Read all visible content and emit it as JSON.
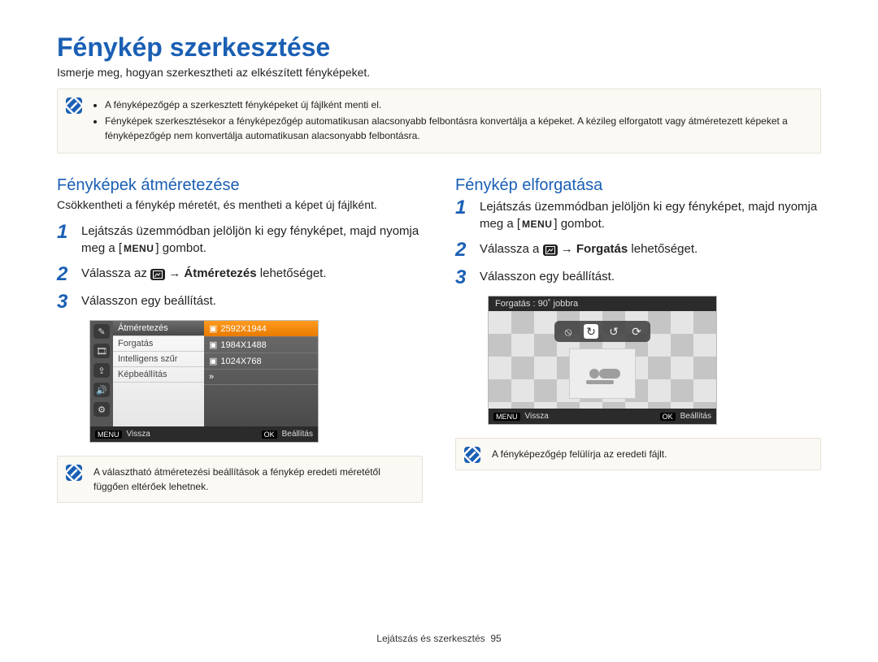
{
  "page": {
    "title": "Fénykép szerkesztése",
    "subtitle": "Ismerje meg, hogyan szerkesztheti az elkészített fényképeket.",
    "footer_section": "Lejátszás és szerkesztés",
    "footer_page": "95"
  },
  "top_note": {
    "bullet1": "A fényképezőgép a szerkesztett fényképeket új fájlként menti el.",
    "bullet2": "Fényképek szerkesztésekor a fényképezőgép automatikusan alacsonyabb felbontásra konvertálja a képeket. A kézileg elforgatott vagy átméretezett képeket a fényképezőgép nem konvertálja automatikusan alacsonyabb felbontásra."
  },
  "left": {
    "title": "Fényképek átméretezése",
    "intro": "Csökkentheti a fénykép méretét, és mentheti a képet új fájlként.",
    "step1a": "Lejátszás üzemmódban jelöljön ki egy fényképet, majd nyomja meg a [",
    "step1b": "] gombot.",
    "menu_label": "MENU",
    "step2a": "Válassza az ",
    "step2b": " → ",
    "step2c": "Átméretezés",
    "step2d": " lehetőséget.",
    "step3": "Válasszon egy beállítást.",
    "cam": {
      "menu": {
        "r1": "Átméretezés",
        "r2": "Forgatás",
        "r3": "Intelligens szűr",
        "r4": "Képbeállítás"
      },
      "vals": {
        "r1": "2592X1944",
        "r2": "1984X1488",
        "r3": "1024X768",
        "r4": "»"
      },
      "foot_back_chip": "MENU",
      "foot_back": "Vissza",
      "foot_ok_chip": "OK",
      "foot_ok": "Beállítás"
    },
    "note": "A választható átméretezési beállítások a fénykép eredeti méretétől függően eltérőek lehetnek."
  },
  "right": {
    "title": "Fénykép elforgatása",
    "step1a": "Lejátszás üzemmódban jelöljön ki egy fényképet, majd nyomja meg a [",
    "step1b": "] gombot.",
    "menu_label": "MENU",
    "step2a": "Válassza a ",
    "step2b": " → ",
    "step2c": "Forgatás",
    "step2d": " lehetőséget.",
    "step3": "Válasszon egy beállítást.",
    "rot": {
      "top": "Forgatás : 90˚ jobbra",
      "foot_back_chip": "MENU",
      "foot_back": "Vissza",
      "foot_ok_chip": "OK",
      "foot_ok": "Beállítás"
    },
    "note": "A fényképezőgép felülírja az eredeti fájlt."
  }
}
